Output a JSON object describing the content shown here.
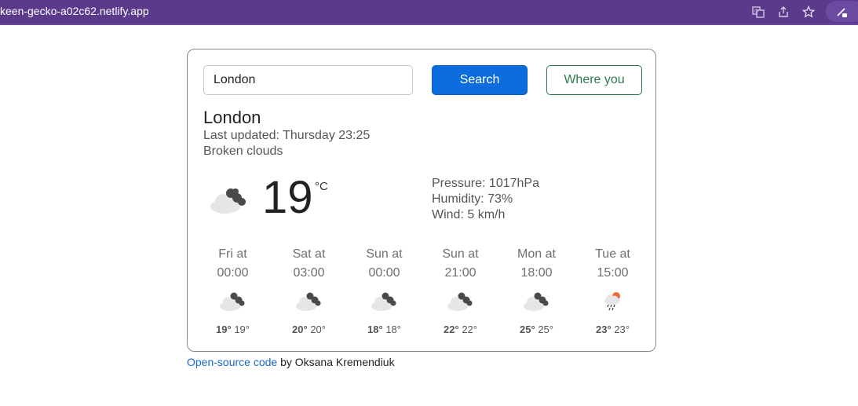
{
  "browser": {
    "url": "keen-gecko-a02c62.netlify.app",
    "icons": [
      "translate-icon",
      "share-icon",
      "star-icon",
      "extension-pen-icon"
    ]
  },
  "search": {
    "value": "London",
    "search_label": "Search",
    "where_label": "Where you"
  },
  "current": {
    "city": "London",
    "updated": "Last updated: Thursday 23:25",
    "description": "Broken clouds",
    "icon": "broken-clouds-icon",
    "temperature": "19",
    "unit": "°C",
    "pressure": "Pressure: 1017hPa",
    "humidity": "Humidity: 73%",
    "wind": "Wind: 5 km/h"
  },
  "forecast": [
    {
      "day": "Fri at",
      "time": "00:00",
      "icon": "broken-clouds-icon",
      "max": "19°",
      "min": "19°"
    },
    {
      "day": "Sat at",
      "time": "03:00",
      "icon": "broken-clouds-icon",
      "max": "20°",
      "min": "20°"
    },
    {
      "day": "Sun at",
      "time": "00:00",
      "icon": "broken-clouds-icon",
      "max": "18°",
      "min": "18°"
    },
    {
      "day": "Sun at",
      "time": "21:00",
      "icon": "broken-clouds-icon",
      "max": "22°",
      "min": "22°"
    },
    {
      "day": "Mon at",
      "time": "18:00",
      "icon": "broken-clouds-icon",
      "max": "25°",
      "min": "25°"
    },
    {
      "day": "Tue at",
      "time": "15:00",
      "icon": "sun-rain-icon",
      "max": "23°",
      "min": "23°"
    }
  ],
  "footer": {
    "link_text": "Open-source code",
    "author_text": "by Oksana Kremendiuk"
  },
  "colors": {
    "browser_bar": "#5b3a8c",
    "primary_button": "#0d6ddf",
    "secondary_button": "#2c7a4b",
    "link": "#1a66c9"
  }
}
